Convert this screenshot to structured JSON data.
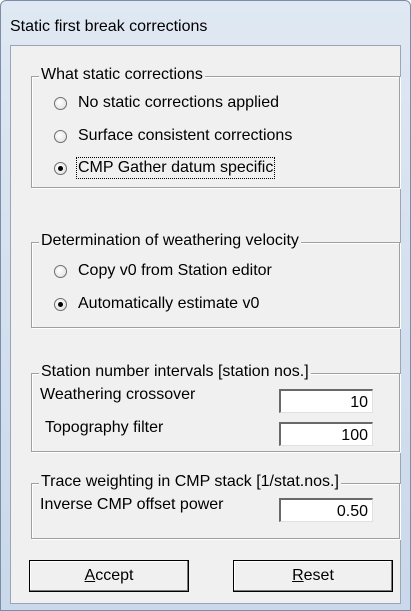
{
  "window": {
    "title": "Static first break corrections"
  },
  "static_group": {
    "legend": "What static corrections",
    "options": [
      {
        "label": "No static corrections applied",
        "checked": false
      },
      {
        "label": "Surface consistent corrections",
        "checked": false
      },
      {
        "label": "CMP Gather datum specific",
        "checked": true
      }
    ]
  },
  "velocity_group": {
    "legend": "Determination of weathering velocity",
    "options": [
      {
        "label": "Copy v0 from Station editor",
        "checked": false
      },
      {
        "label": "Automatically estimate v0",
        "checked": true
      }
    ]
  },
  "interval_group": {
    "legend": "Station number intervals [station nos.]",
    "weathering_label": "Weathering crossover",
    "weathering_value": "10",
    "topography_label": "Topography filter",
    "topography_value": "100"
  },
  "trace_group": {
    "legend": "Trace weighting in CMP stack [1/stat.nos.]",
    "offset_label": "Inverse CMP offset power",
    "offset_value": "0.50"
  },
  "buttons": {
    "accept_mnemonic": "A",
    "accept_rest": "ccept",
    "reset_mnemonic": "R",
    "reset_rest": "eset"
  }
}
